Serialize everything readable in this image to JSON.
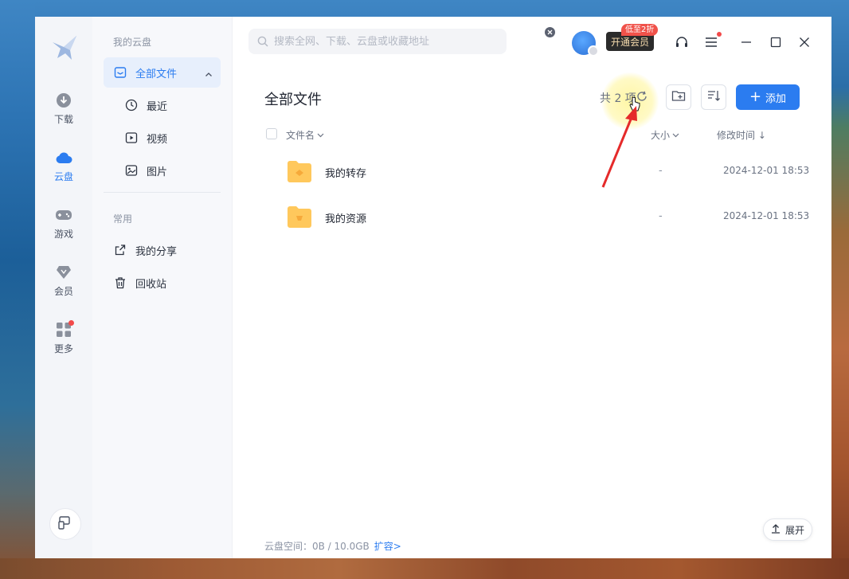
{
  "rail": {
    "items": [
      {
        "label": "下载",
        "icon": "download-icon"
      },
      {
        "label": "云盘",
        "icon": "cloud-icon"
      },
      {
        "label": "游戏",
        "icon": "gamepad-icon"
      },
      {
        "label": "会员",
        "icon": "diamond-icon"
      },
      {
        "label": "更多",
        "icon": "apps-grid-icon"
      }
    ],
    "bottom_icon": "device-icon"
  },
  "subnav": {
    "section_mydisk": "我的云盘",
    "items": [
      {
        "label": "全部文件",
        "icon": "folder-box-icon"
      },
      {
        "label": "最近",
        "icon": "clock-icon"
      },
      {
        "label": "视频",
        "icon": "video-icon"
      },
      {
        "label": "图片",
        "icon": "image-icon"
      }
    ],
    "section_common": "常用",
    "common_items": [
      {
        "label": "我的分享",
        "icon": "share-icon"
      },
      {
        "label": "回收站",
        "icon": "trash-icon"
      }
    ]
  },
  "header": {
    "search_placeholder": "搜索全网、下载、云盘或收藏地址",
    "vip_button": "开通会员",
    "vip_tag": "低至2折"
  },
  "main": {
    "title": "全部文件",
    "count": "共 2 项",
    "add_button": "添加",
    "columns": {
      "name": "文件名",
      "size": "大小",
      "modified": "修改时间 ↓"
    },
    "files": [
      {
        "name": "我的转存",
        "size": "-",
        "modified": "2024-12-01 18:53"
      },
      {
        "name": "我的资源",
        "size": "-",
        "modified": "2024-12-01 18:53"
      }
    ],
    "footer_storage": "云盘空间：0B / 10.0GB",
    "footer_expand": "扩容>",
    "unfold_button": "展开"
  },
  "colors": {
    "accent": "#2b7cf0",
    "vip_bg": "#2b2b2b",
    "vip_text": "#f7dcae",
    "tag_red": "#f0524a",
    "folder": "#ffc85c"
  }
}
